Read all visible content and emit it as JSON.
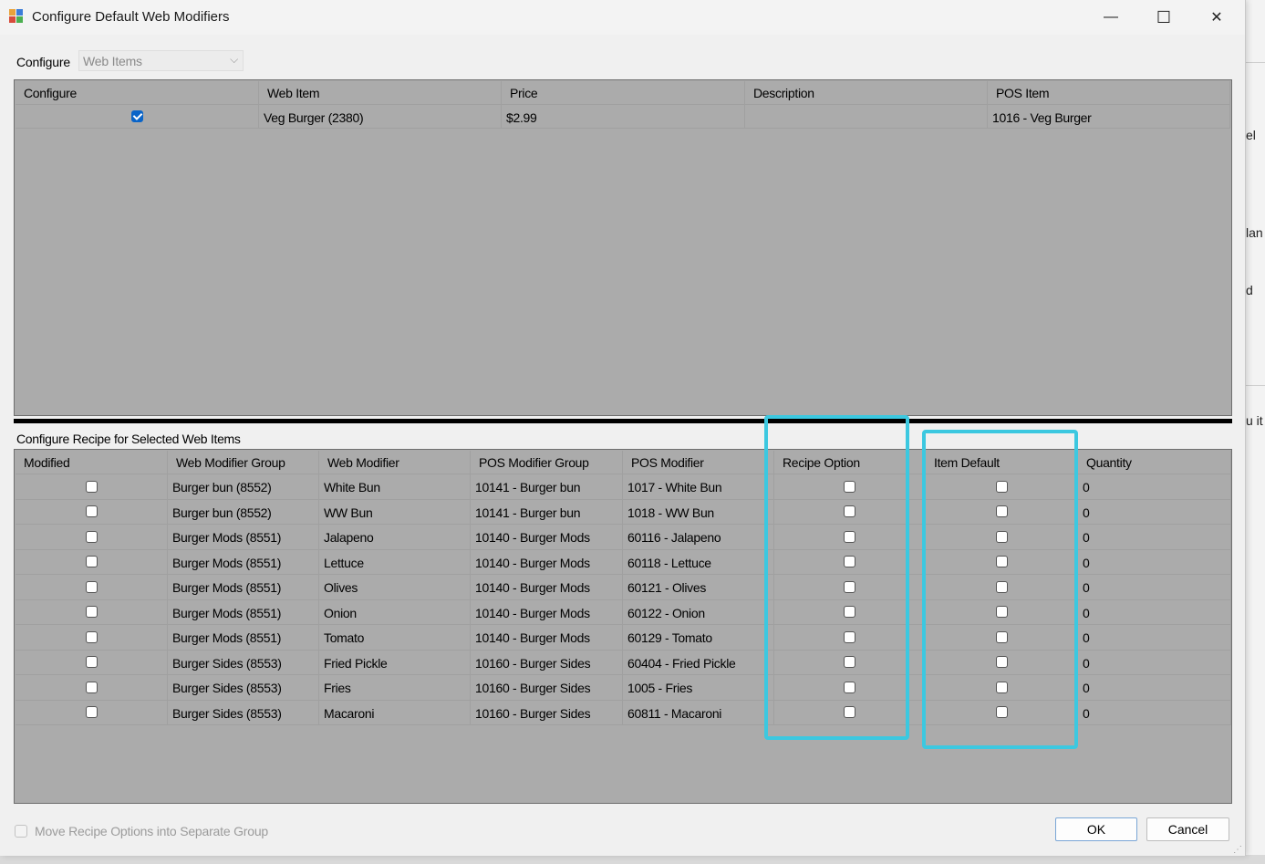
{
  "window": {
    "title": "Configure Default Web Modifiers",
    "min_glyph": "—",
    "max_glyph": "☐",
    "close_glyph": "✕"
  },
  "background_window": {
    "fragments": [
      "el",
      "lan",
      "d",
      "u it"
    ]
  },
  "config": {
    "label": "Configure",
    "selected": "Web Items",
    "arrow": "⌵"
  },
  "web_items": {
    "columns": [
      "Configure",
      "Web Item",
      "Price",
      "Description",
      "POS Item"
    ],
    "rows": [
      {
        "configure": true,
        "web_item": "Veg Burger (2380)",
        "price": "$2.99",
        "description": "",
        "pos_item": "1016 - Veg Burger"
      }
    ]
  },
  "recipe": {
    "label": "Configure Recipe for Selected Web Items",
    "columns": [
      "Modified",
      "Web Modifier Group",
      "Web Modifier",
      "POS Modifier Group",
      "POS Modifier",
      "Recipe Option",
      "Item Default",
      "Quantity"
    ],
    "rows": [
      {
        "group": "Burger bun (8552)",
        "modifier": "White Bun",
        "pos_group": "10141 - Burger bun",
        "pos_modifier": "1017 - White Bun",
        "quantity": "0"
      },
      {
        "group": "Burger bun (8552)",
        "modifier": "WW Bun",
        "pos_group": "10141 - Burger bun",
        "pos_modifier": "1018 - WW Bun",
        "quantity": "0"
      },
      {
        "group": "Burger Mods (8551)",
        "modifier": "Jalapeno",
        "pos_group": "10140 - Burger Mods",
        "pos_modifier": "60116 - Jalapeno",
        "quantity": "0"
      },
      {
        "group": "Burger Mods (8551)",
        "modifier": "Lettuce",
        "pos_group": "10140 - Burger Mods",
        "pos_modifier": "60118 - Lettuce",
        "quantity": "0"
      },
      {
        "group": "Burger Mods (8551)",
        "modifier": "Olives",
        "pos_group": "10140 - Burger Mods",
        "pos_modifier": "60121 - Olives",
        "quantity": "0"
      },
      {
        "group": "Burger Mods (8551)",
        "modifier": "Onion",
        "pos_group": "10140 - Burger Mods",
        "pos_modifier": "60122 - Onion",
        "quantity": "0"
      },
      {
        "group": "Burger Mods (8551)",
        "modifier": "Tomato",
        "pos_group": "10140 - Burger Mods",
        "pos_modifier": "60129 - Tomato",
        "quantity": "0"
      },
      {
        "group": "Burger Sides (8553)",
        "modifier": "Fried Pickle",
        "pos_group": "10160 - Burger Sides",
        "pos_modifier": "60404 - Fried Pickle",
        "quantity": "0"
      },
      {
        "group": "Burger Sides (8553)",
        "modifier": "Fries",
        "pos_group": "10160 - Burger Sides",
        "pos_modifier": "1005 - Fries",
        "quantity": "0"
      },
      {
        "group": "Burger Sides (8553)",
        "modifier": "Macaroni",
        "pos_group": "10160 - Burger Sides",
        "pos_modifier": "60811 - Macaroni",
        "quantity": "0"
      }
    ]
  },
  "footer": {
    "move_option_label": "Move Recipe Options into Separate Group",
    "ok_label": "OK",
    "cancel_label": "Cancel"
  },
  "colors": {
    "highlight": "#3cc8e0",
    "grid_empty": "#ababab",
    "check_blue": "#0a64c8"
  }
}
